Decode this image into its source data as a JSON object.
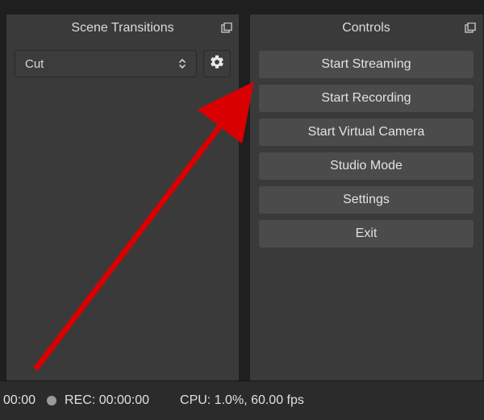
{
  "panels": {
    "scene_transitions": {
      "title": "Scene Transitions",
      "combo_value": "Cut"
    },
    "controls": {
      "title": "Controls",
      "buttons": {
        "start_streaming": "Start Streaming",
        "start_recording": "Start Recording",
        "start_virtual_camera": "Start Virtual Camera",
        "studio_mode": "Studio Mode",
        "settings": "Settings",
        "exit": "Exit"
      }
    }
  },
  "status": {
    "partial_left": "00:00",
    "rec_label": "REC:",
    "rec_time": "00:00:00",
    "cpu_label": "CPU:",
    "cpu_value": "1.0%, 60.00 fps"
  }
}
